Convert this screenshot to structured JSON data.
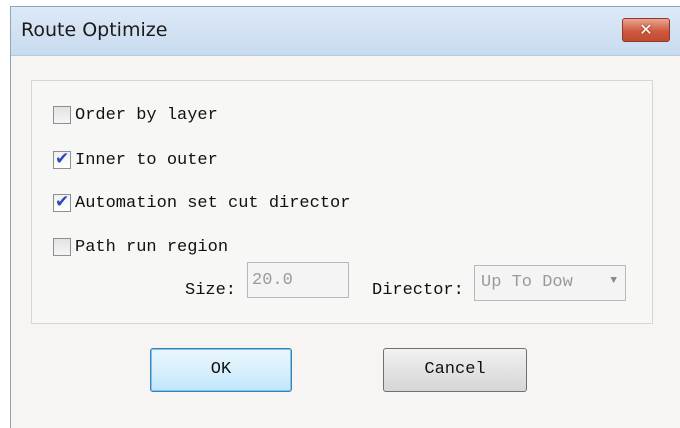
{
  "window": {
    "title": "Route Optimize",
    "close_glyph": "✕"
  },
  "options": [
    {
      "label": "Order by layer",
      "checked": false
    },
    {
      "label": "Inner to outer",
      "checked": true
    },
    {
      "label": "Automation set cut director",
      "checked": true
    },
    {
      "label": "Path run region",
      "checked": false
    }
  ],
  "size": {
    "label": "Size:",
    "value": "20.0"
  },
  "director": {
    "label": "Director:",
    "value": "Up To Dow",
    "arrow": "▼"
  },
  "buttons": {
    "ok": "OK",
    "cancel": "Cancel"
  },
  "tick_glyph": "✔",
  "icons": {
    "close": "close-icon",
    "check": "check-icon",
    "dropdown": "chevron-down-icon"
  },
  "colors": {
    "accent": "#2a4bb8",
    "close_red": "#cf5a3f",
    "title_bar": "#c9dbef"
  }
}
